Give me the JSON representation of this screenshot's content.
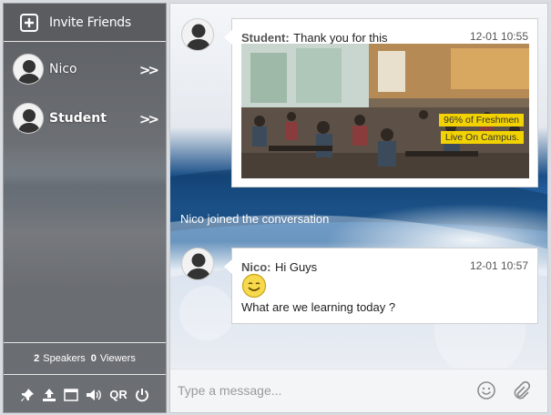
{
  "sidebar": {
    "invite_label": "Invite Friends",
    "users": [
      {
        "name": "Nico"
      },
      {
        "name": "Student"
      }
    ],
    "counts": {
      "speakers": "2",
      "speakers_label": "Speakers",
      "viewers": "0",
      "viewers_label": "Viewers"
    },
    "toolbar": {
      "icons": [
        "pin-icon",
        "upload-icon",
        "window-icon",
        "volume-icon",
        "qr-icon",
        "power-icon"
      ],
      "qr_label": "QR"
    }
  },
  "chat": {
    "messages": [
      {
        "sender": "Student:",
        "text": "Thank you for this",
        "time": "12-01 10:55",
        "image_caption": [
          "96% of Freshmen",
          "Live On Campus."
        ]
      },
      {
        "sender": "Nico:",
        "text": "Hi Guys",
        "time": "12-01 10:57",
        "emoji": "smiley-icon",
        "text2": "What are we learning today ?"
      }
    ],
    "system_message": "Nico joined the conversation",
    "composer": {
      "placeholder": "Type a message...",
      "icons": [
        "emoji-icon",
        "attach-icon"
      ]
    }
  },
  "colors": {
    "sidebar": "#6d7075",
    "caption_bg": "#f2d200",
    "chat_band": "#1b5d9c"
  }
}
